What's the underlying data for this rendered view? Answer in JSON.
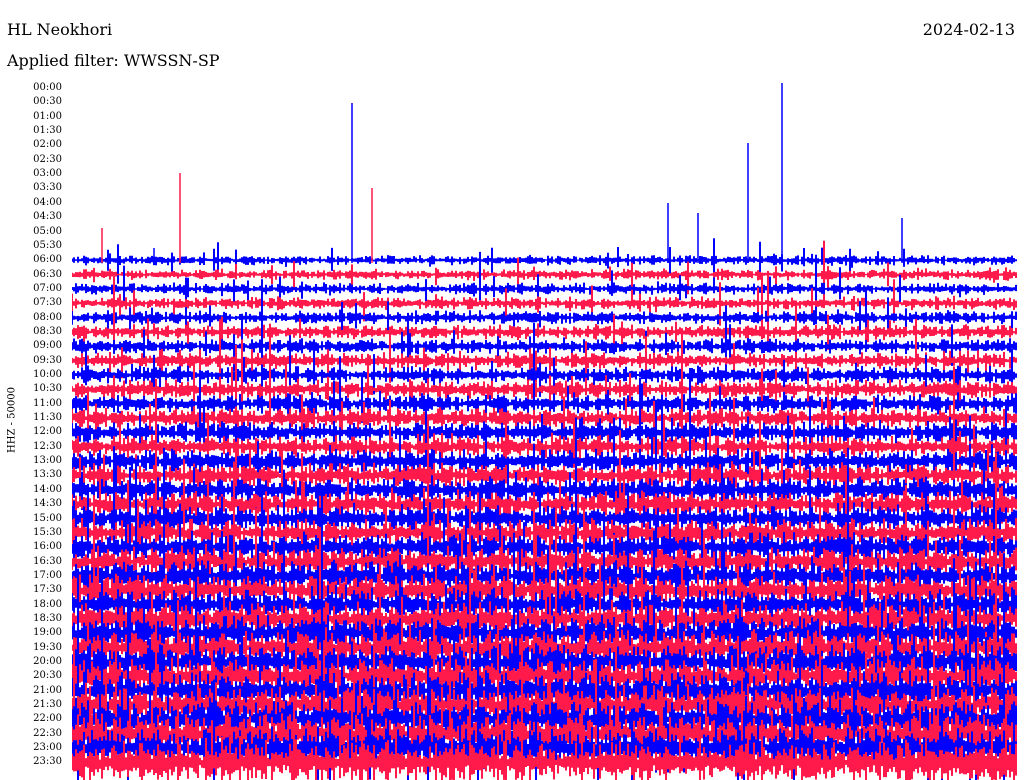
{
  "header": {
    "station": "HL Neokhori",
    "date": "2024-02-13",
    "filter": "Applied filter: WWSSN-SP"
  },
  "chart_data": {
    "type": "helicorder",
    "channel_label": "HHZ - 50000",
    "row_labels": [
      "00:00",
      "00:30",
      "01:00",
      "01:30",
      "02:00",
      "02:30",
      "03:00",
      "03:30",
      "04:00",
      "04:30",
      "05:00",
      "05:30",
      "06:00",
      "06:30",
      "07:00",
      "07:30",
      "08:00",
      "08:30",
      "09:00",
      "09:30",
      "10:00",
      "10:30",
      "11:00",
      "11:30",
      "12:00",
      "12:30",
      "13:00",
      "13:30",
      "14:00",
      "14:30",
      "15:00",
      "15:30",
      "16:00",
      "16:30",
      "17:00",
      "17:30",
      "18:00",
      "18:30",
      "19:00",
      "19:30",
      "20:00",
      "20:30",
      "21:00",
      "21:30",
      "22:00",
      "22:30",
      "23:00",
      "23:30"
    ],
    "trace_colors": [
      "#0000ff",
      "#ff1a4b"
    ],
    "first_trace_row": "06:00"
  }
}
